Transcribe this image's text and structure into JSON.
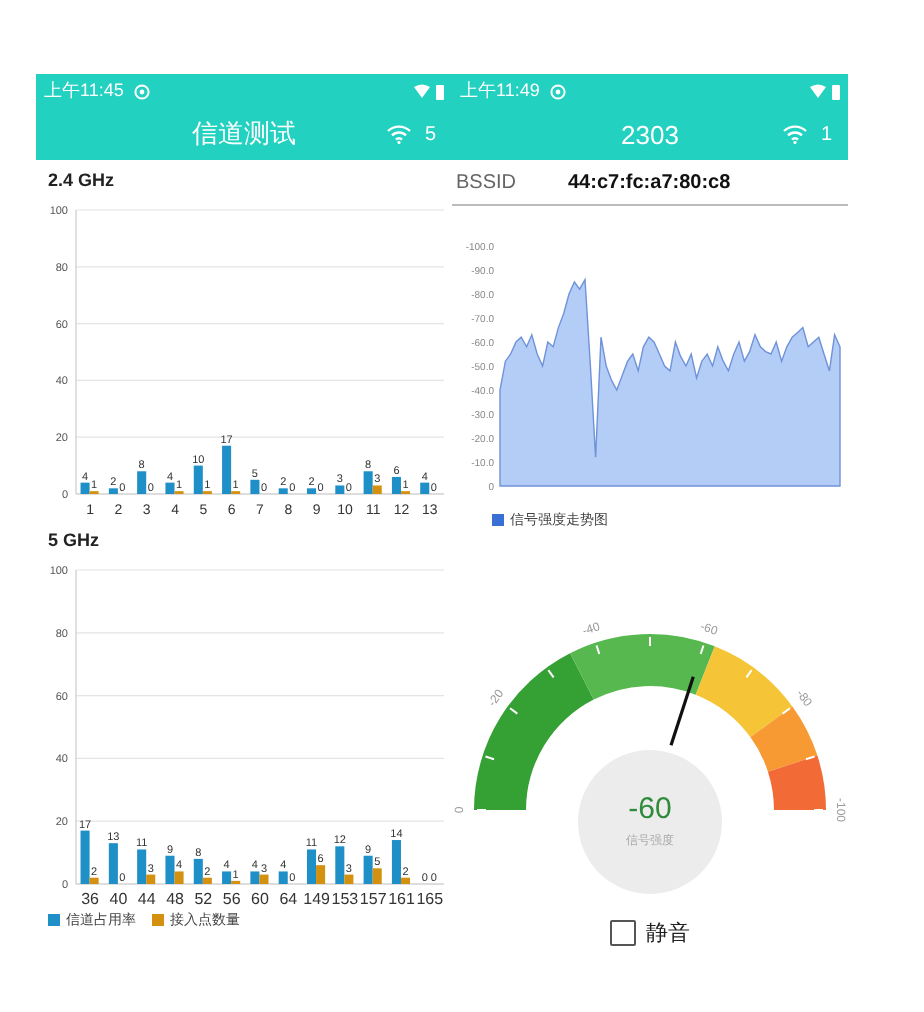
{
  "left_screen": {
    "status_bar": {
      "time": "上午11:45"
    },
    "title_bar": {
      "title": "信道测试",
      "wifi_count": "5"
    },
    "bands": [
      {
        "label": "2.4 GHz",
        "chart_data": {
          "type": "bar",
          "categories": [
            "1",
            "2",
            "3",
            "4",
            "5",
            "6",
            "7",
            "8",
            "9",
            "10",
            "11",
            "12",
            "13"
          ],
          "ylim": [
            0,
            100
          ],
          "yticks": [
            0,
            20,
            40,
            60,
            80,
            100
          ],
          "grid": true,
          "data_labels": true,
          "series": [
            {
              "color": "#1f8fc8",
              "values": [
                4,
                2,
                8,
                4,
                10,
                17,
                5,
                2,
                2,
                3,
                8,
                6,
                4
              ]
            },
            {
              "color": "#d4900f",
              "values": [
                1,
                0,
                0,
                1,
                1,
                1,
                0,
                0,
                0,
                0,
                3,
                1,
                0
              ]
            }
          ]
        }
      },
      {
        "label": "5 GHz",
        "chart_data": {
          "type": "bar",
          "categories": [
            "36",
            "40",
            "44",
            "48",
            "52",
            "56",
            "60",
            "64",
            "149",
            "153",
            "157",
            "161",
            "165"
          ],
          "ylim": [
            0,
            100
          ],
          "yticks": [
            0,
            20,
            40,
            60,
            80,
            100
          ],
          "grid": true,
          "data_labels": true,
          "series": [
            {
              "name": "信道占用率",
              "color": "#1f8fc8",
              "values": [
                17,
                13,
                11,
                9,
                8,
                4,
                4,
                4,
                11,
                12,
                9,
                14,
                0
              ]
            },
            {
              "name": "接入点数量",
              "color": "#d4900f",
              "values": [
                2,
                0,
                3,
                4,
                2,
                1,
                3,
                0,
                6,
                3,
                5,
                2,
                0
              ]
            }
          ]
        }
      }
    ]
  },
  "right_screen": {
    "status_bar": {
      "time": "上午11:49"
    },
    "title_bar": {
      "title": "2303",
      "wifi_count": "1"
    },
    "bssid": {
      "label": "BSSID",
      "value": "44:c7:fc:a7:80:c8"
    },
    "signal_chart": {
      "yticks": [
        "-100.0",
        "-90.0",
        "-80.0",
        "-70.0",
        "-60.0",
        "-50.0",
        "-40.0",
        "-30.0",
        "-20.0",
        "-10.0",
        "0"
      ],
      "legend": "信号强度走势图"
    },
    "gauge": {
      "ticks": [
        "0",
        "-20",
        "-40",
        "-60",
        "-80",
        "-100"
      ],
      "value": "-60",
      "caption": "信号强度"
    },
    "mute": {
      "label": "静音",
      "checked": false
    }
  }
}
